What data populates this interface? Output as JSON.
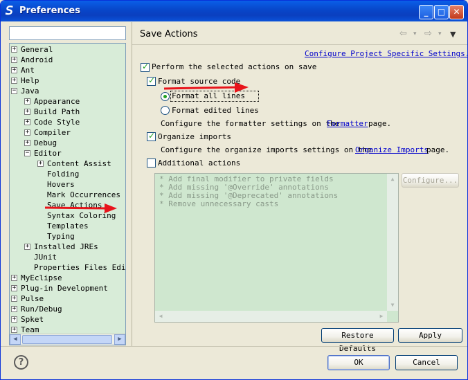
{
  "window": {
    "title": "Preferences",
    "app_icon_glyph": "𝘚"
  },
  "titlebar": {
    "minimize": "_",
    "maximize": "□",
    "close": "✕"
  },
  "sidebar": {
    "filter_placeholder": "",
    "items": [
      {
        "label": "General",
        "expander": "+"
      },
      {
        "label": "Android",
        "expander": "+"
      },
      {
        "label": "Ant",
        "expander": "+"
      },
      {
        "label": "Help",
        "expander": "+"
      },
      {
        "label": "Java",
        "expander": "−"
      },
      {
        "label": "Appearance",
        "expander": "+"
      },
      {
        "label": "Build Path",
        "expander": "+"
      },
      {
        "label": "Code Style",
        "expander": "+"
      },
      {
        "label": "Compiler",
        "expander": "+"
      },
      {
        "label": "Debug",
        "expander": "+"
      },
      {
        "label": "Editor",
        "expander": "−"
      },
      {
        "label": "Content Assist",
        "expander": "+"
      },
      {
        "label": "Folding",
        "expander": ""
      },
      {
        "label": "Hovers",
        "expander": ""
      },
      {
        "label": "Mark Occurrences",
        "expander": ""
      },
      {
        "label": "Save Actions",
        "expander": ""
      },
      {
        "label": "Syntax Coloring",
        "expander": ""
      },
      {
        "label": "Templates",
        "expander": ""
      },
      {
        "label": "Typing",
        "expander": ""
      },
      {
        "label": "Installed JREs",
        "expander": "+"
      },
      {
        "label": "JUnit",
        "expander": ""
      },
      {
        "label": "Properties Files Edit",
        "expander": ""
      },
      {
        "label": "MyEclipse",
        "expander": "+"
      },
      {
        "label": "Plug-in Development",
        "expander": "+"
      },
      {
        "label": "Pulse",
        "expander": "+"
      },
      {
        "label": "Run/Debug",
        "expander": "+"
      },
      {
        "label": "Spket",
        "expander": "+"
      },
      {
        "label": "Team",
        "expander": "+"
      }
    ],
    "scroll_left": "◀",
    "scroll_right": "▶"
  },
  "page": {
    "title": "Save Actions",
    "nav_back": "⇦",
    "nav_forward": "⇨",
    "menu": "▼",
    "configure_link": "Configure Project Specific Settings...",
    "perform_label": "Perform the selected actions on save",
    "format_label": "Format source code",
    "format_all": "Format all lines",
    "format_edited": "Format edited lines",
    "formatter_text_before": "Configure the formatter settings on the",
    "formatter_link": "Formatter",
    "formatter_text_after": "page.",
    "organize_label": "Organize imports",
    "organize_text_before": "Configure the organize imports settings on the",
    "organize_link": "Organize Imports",
    "organize_text_after": "page.",
    "additional_label": "Additional actions",
    "additional_items": [
      "* Add final modifier to private fields",
      "* Add missing '@Override' annotations",
      "* Add missing '@Deprecated' annotations",
      "* Remove unnecessary casts"
    ],
    "configure_button": "Configure...",
    "restore_defaults": "Restore Defaults",
    "apply": "Apply"
  },
  "footer": {
    "help": "?",
    "ok": "OK",
    "cancel": "Cancel"
  },
  "colors": {
    "tree_bg": "#d8ecd8",
    "annotation_arrow": "#e8141b",
    "link": "#0000cc"
  }
}
